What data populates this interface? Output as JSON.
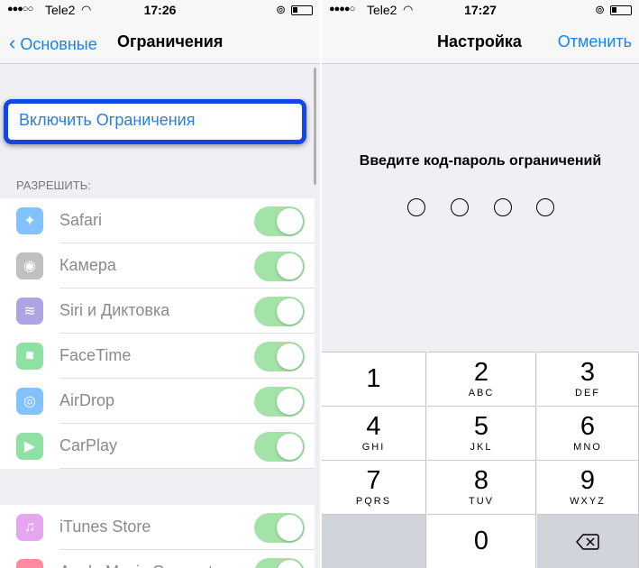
{
  "left": {
    "status": {
      "signal": "●●●○○",
      "carrier": "Tele2",
      "time": "17:26"
    },
    "nav": {
      "back_label": "Основные",
      "title": "Ограничения"
    },
    "enable_label": "Включить Ограничения",
    "section_header": "РАЗРЕШИТЬ:",
    "items": [
      {
        "label": "Safari",
        "icon": "safari-icon",
        "on": true
      },
      {
        "label": "Камера",
        "icon": "camera-icon",
        "on": true
      },
      {
        "label": "Siri и Диктовка",
        "icon": "siri-icon",
        "on": true
      },
      {
        "label": "FaceTime",
        "icon": "facetime-icon",
        "on": true
      },
      {
        "label": "AirDrop",
        "icon": "airdrop-icon",
        "on": true
      },
      {
        "label": "CarPlay",
        "icon": "carplay-icon",
        "on": true
      }
    ],
    "items2": [
      {
        "label": "iTunes Store",
        "icon": "itunes-icon",
        "on": true
      },
      {
        "label": "Apple Music Connect",
        "icon": "music-icon",
        "on": true
      }
    ]
  },
  "right": {
    "status": {
      "signal": "●●●●○",
      "carrier": "Tele2",
      "time": "17:27"
    },
    "nav": {
      "title": "Настройка",
      "cancel_label": "Отменить"
    },
    "prompt": "Введите код-пароль ограничений",
    "keys": [
      {
        "digit": "1",
        "letters": ""
      },
      {
        "digit": "2",
        "letters": "ABC"
      },
      {
        "digit": "3",
        "letters": "DEF"
      },
      {
        "digit": "4",
        "letters": "GHI"
      },
      {
        "digit": "5",
        "letters": "JKL"
      },
      {
        "digit": "6",
        "letters": "MNO"
      },
      {
        "digit": "7",
        "letters": "PQRS"
      },
      {
        "digit": "8",
        "letters": "TUV"
      },
      {
        "digit": "9",
        "letters": "WXYZ"
      },
      {
        "digit": "0",
        "letters": ""
      }
    ]
  },
  "colors": {
    "accent": "#1a82e6",
    "highlight_frame": "#1346e6",
    "toggle_on": "#a3e3a8"
  }
}
